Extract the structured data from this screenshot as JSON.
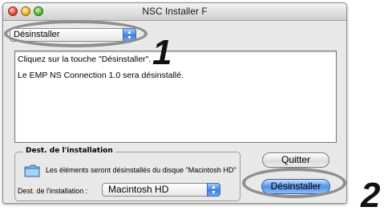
{
  "window": {
    "title": "NSC Installer F"
  },
  "mode_popup": {
    "value": "Désinstaller"
  },
  "message": {
    "line1": "Cliquez sur la touche \"Désinstaller\".",
    "line2": "Le EMP NS Connection 1.0 sera désinstallé."
  },
  "destination_group": {
    "title": "Dest. de l'installation",
    "description": "Les éléments seront désinstallés du disque \"Macintosh HD\"",
    "label": "Dest. de l'installation :",
    "selected": "Macintosh HD"
  },
  "buttons": {
    "quit": "Quitter",
    "uninstall": "Désinstaller"
  },
  "annotations": {
    "step1": "1",
    "step2": "2"
  },
  "icons": {
    "folder": "folder-icon",
    "popup_arrows": "updown-arrows-icon"
  }
}
